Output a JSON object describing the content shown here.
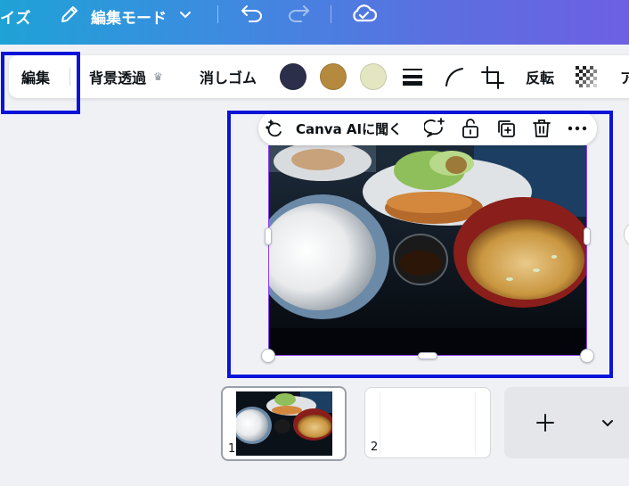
{
  "header": {
    "title_fragment": "イズ",
    "mode_label": "編集モード",
    "icons": [
      "pencil-icon",
      "chevron-down-icon",
      "undo-icon",
      "redo-icon",
      "cloud-saved-icon"
    ]
  },
  "toolbar": {
    "edit_label": "編集",
    "bg_remove_label": "背景透過",
    "eraser_label": "消しゴム",
    "flip_label": "反転",
    "truncated_label": "ア",
    "swatches": [
      "#2b2f4a",
      "#b58a3e",
      "#e3e6c0"
    ],
    "icons": [
      "crown-icon",
      "line-weight-icon",
      "curve-icon",
      "crop-icon",
      "transparency-icon"
    ]
  },
  "float_bar": {
    "ai_label": "Canva AIに聞く",
    "icons": [
      "magic-sparkle-icon",
      "comment-add-icon",
      "unlock-icon",
      "duplicate-icon",
      "trash-icon",
      "more-icon"
    ]
  },
  "pages": {
    "page1_num": "1",
    "page2_num": "2",
    "icons": [
      "plus-icon",
      "chevron-down-icon"
    ]
  },
  "colors": {
    "accent_purple": "#8b3dff",
    "highlight_blue": "#0a14d8"
  }
}
